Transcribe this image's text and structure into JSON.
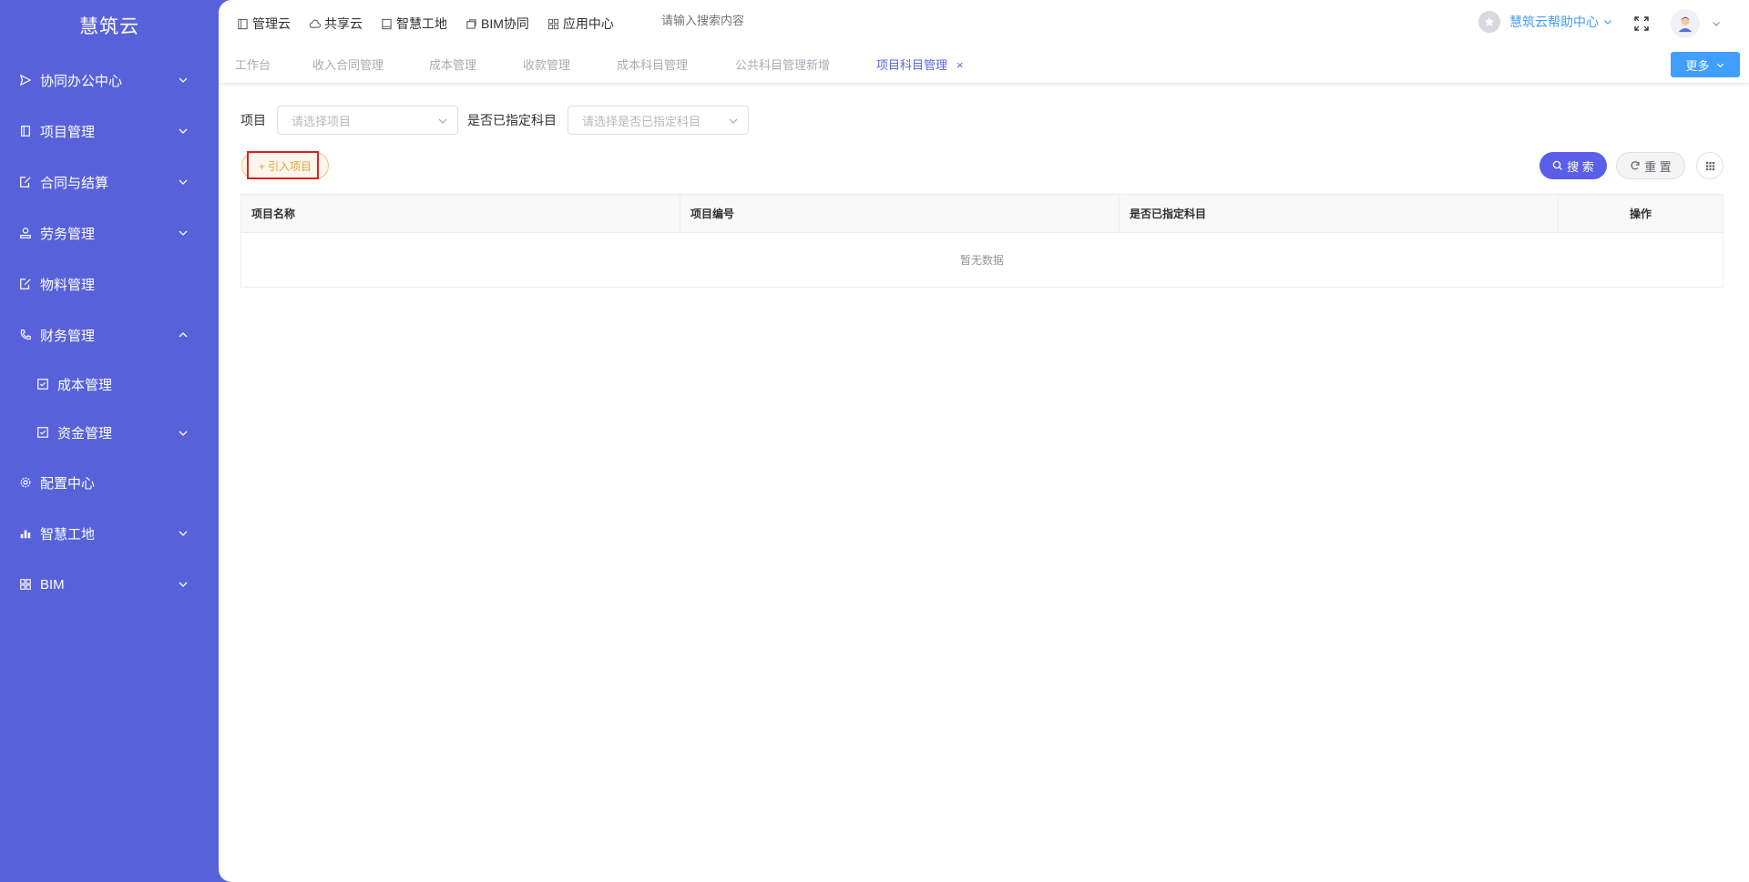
{
  "sidebar": {
    "logo": "慧筑云",
    "items": [
      {
        "label": "协同办公中心"
      },
      {
        "label": "项目管理"
      },
      {
        "label": "合同与结算"
      },
      {
        "label": "劳务管理"
      },
      {
        "label": "物料管理"
      },
      {
        "label": "财务管理"
      },
      {
        "label": "成本管理"
      },
      {
        "label": "资金管理"
      },
      {
        "label": "配置中心"
      },
      {
        "label": "智慧工地"
      },
      {
        "label": "BIM"
      }
    ]
  },
  "topnav": {
    "links": [
      "管理云",
      "共享云",
      "智慧工地",
      "BIM协同",
      "应用中心"
    ],
    "search_placeholder": "请输入搜索内容",
    "help_label": "慧筑云帮助中心"
  },
  "tabs": [
    "工作台",
    "收入合同管理",
    "成本管理",
    "收款管理",
    "成本科目管理",
    "公共科目管理新增",
    "项目科目管理"
  ],
  "tab_close": "×",
  "more_label": "更多",
  "filter": {
    "project_label": "项目",
    "project_placeholder": "请选择项目",
    "assigned_label": "是否已指定科目",
    "assigned_placeholder": "请选择是否已指定科目"
  },
  "actions": {
    "import_label": "+ 引入项目",
    "search_label": "搜 索",
    "reset_label": "重 置"
  },
  "table": {
    "columns": [
      "项目名称",
      "项目编号",
      "是否已指定科目",
      "操作"
    ],
    "empty_text": "暂无数据"
  },
  "colors": {
    "sidebar_bg": "#5762da",
    "accent": "#5b5fe8",
    "primary_button": "#409eff",
    "warning": "#e6a23c",
    "highlight_border": "#e02020"
  }
}
